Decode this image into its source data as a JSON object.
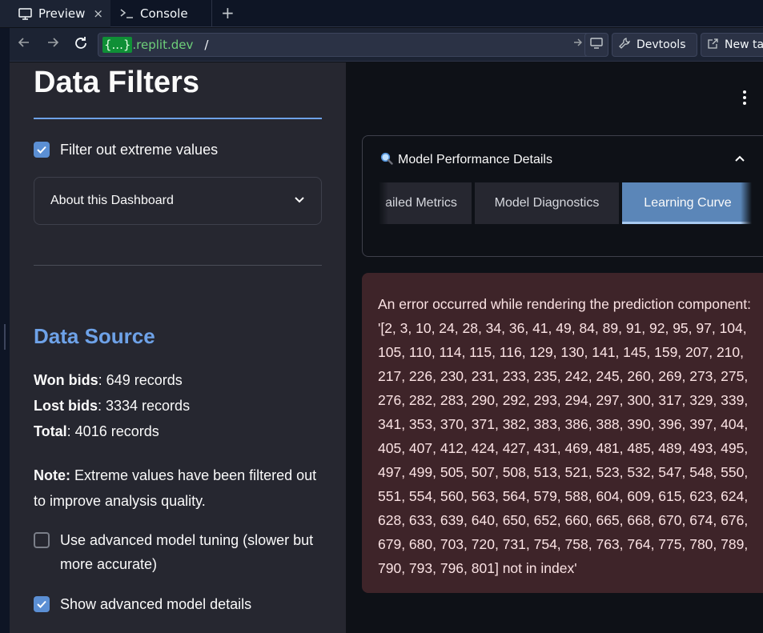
{
  "chrome": {
    "tabs": [
      {
        "label": "Preview",
        "icon": "monitor-icon",
        "active": true
      },
      {
        "label": "Console",
        "icon": "terminal-icon",
        "active": false
      }
    ],
    "close_glyph": "×",
    "new_tab_glyph": "+",
    "url_host_highlight": "{...}",
    "url_host": ".replit.dev",
    "url_path": "/",
    "devtools_label": "Devtools",
    "new_tab_label": "New tab"
  },
  "sidebar": {
    "title": "Data Filters",
    "filter_extreme": {
      "label": "Filter out extreme values",
      "checked": true
    },
    "expander_label": "About this Dashboard",
    "data_source_title": "Data Source",
    "stats": [
      {
        "label": "Won bids",
        "value": ": 649 records"
      },
      {
        "label": "Lost bids",
        "value": ": 3334 records"
      },
      {
        "label": "Total",
        "value": ": 4016 records"
      }
    ],
    "note_label": "Note:",
    "note_text": " Extreme values have been filtered out to improve analysis quality.",
    "advanced_tuning": {
      "label": "Use advanced model tuning (slower but more accurate)",
      "checked": false
    },
    "show_details": {
      "label": "Show advanced model details",
      "checked": true
    }
  },
  "main": {
    "panel_title": "Model Performance Details",
    "panel_icon": "magnifier-icon",
    "tabs": [
      "ailed Metrics",
      "Model Diagnostics",
      "Learning Curve"
    ],
    "active_tab": 2,
    "error_text": "An error occurred while rendering the prediction component: '[2, 3, 10, 24, 28, 34, 36, 41, 49, 84, 89, 91, 92, 95, 97, 104, 105, 110, 114, 115, 116, 129, 130, 141, 145, 159, 207, 210, 217, 226, 230, 231, 233, 235, 242, 245, 260, 269, 273, 275, 276, 282, 283, 290, 292, 293, 294, 297, 300, 317, 329, 339, 341, 353, 370, 371, 382, 383, 386, 388, 390, 396, 397, 404, 405, 407, 412, 424, 427, 431, 469, 481, 485, 489, 493, 495, 497, 499, 505, 507, 508, 513, 521, 523, 532, 547, 548, 550, 551, 554, 560, 563, 564, 579, 588, 604, 609, 615, 623, 624, 628, 633, 639, 640, 650, 652, 660, 665, 668, 670, 674, 676, 679, 680, 703, 720, 731, 754, 758, 763, 764, 775, 780, 789, 790, 793, 796, 801] not in index'"
  },
  "colors": {
    "accent_blue": "#6ea2e8",
    "checkbox": "#5b8fd4",
    "active_tab": "#5b86b8",
    "error_bg": "#3e2429",
    "sidebar_bg": "#262730",
    "main_bg": "#0e1117"
  }
}
